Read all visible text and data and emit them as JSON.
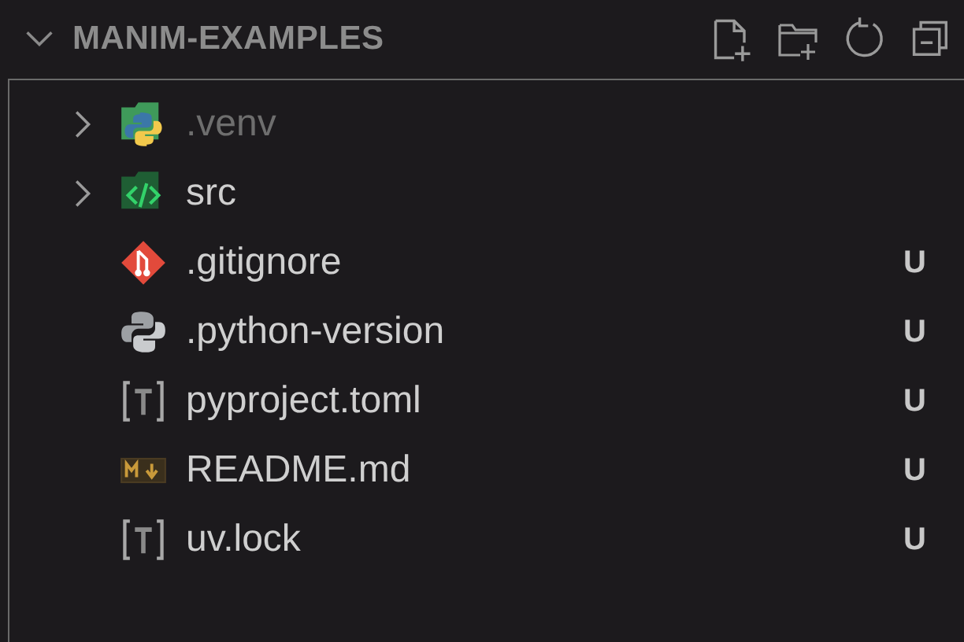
{
  "explorer": {
    "title": "MANIM-EXAMPLES",
    "expanded": true
  },
  "items": [
    {
      "kind": "pyfolder",
      "name": ".venv",
      "dimmed": true,
      "expanded": false
    },
    {
      "kind": "codefolder",
      "name": "src",
      "dimmed": false,
      "expanded": false
    },
    {
      "kind": "gitfile",
      "name": ".gitignore",
      "dimmed": false,
      "status": "U"
    },
    {
      "kind": "pyfile",
      "name": ".python-version",
      "dimmed": false,
      "status": "U"
    },
    {
      "kind": "tomlfile",
      "name": "pyproject.toml",
      "dimmed": false,
      "status": "U"
    },
    {
      "kind": "mdfile",
      "name": "README.md",
      "dimmed": false,
      "status": "U"
    },
    {
      "kind": "tomlfile",
      "name": "uv.lock",
      "dimmed": false,
      "status": "U"
    }
  ]
}
